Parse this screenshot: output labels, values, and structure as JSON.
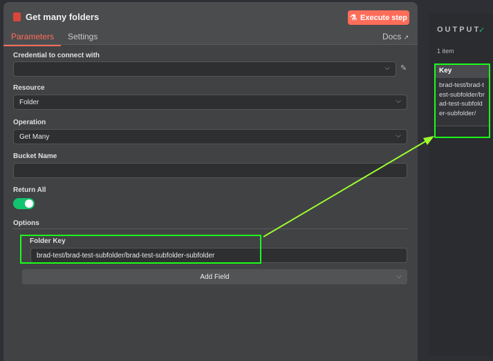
{
  "node": {
    "title": "Get many folders",
    "execute_label": "Execute step",
    "tabs": [
      "Parameters",
      "Settings"
    ],
    "docs_label": "Docs"
  },
  "fields": {
    "credential": {
      "label": "Credential to connect with",
      "value": ""
    },
    "resource": {
      "label": "Resource",
      "value": "Folder"
    },
    "operation": {
      "label": "Operation",
      "value": "Get Many"
    },
    "bucket": {
      "label": "Bucket Name",
      "value": ""
    },
    "return_all": {
      "label": "Return All",
      "on": true
    },
    "options": {
      "label": "Options"
    },
    "folder_key": {
      "label": "Folder Key",
      "value": "brad-test/brad-test-subfolder/brad-test-subfolder-subfolder"
    },
    "add_field_label": "Add Field"
  },
  "output": {
    "title": "OUTPUT",
    "count": "1 item",
    "column": "Key",
    "cell": "brad-test/brad-test-subfolder/brad-test-subfolder-subfolder/"
  },
  "colors": {
    "accent": "#ff6d5a",
    "highlight": "#1aff1a",
    "arrow": "#9dff2e"
  }
}
